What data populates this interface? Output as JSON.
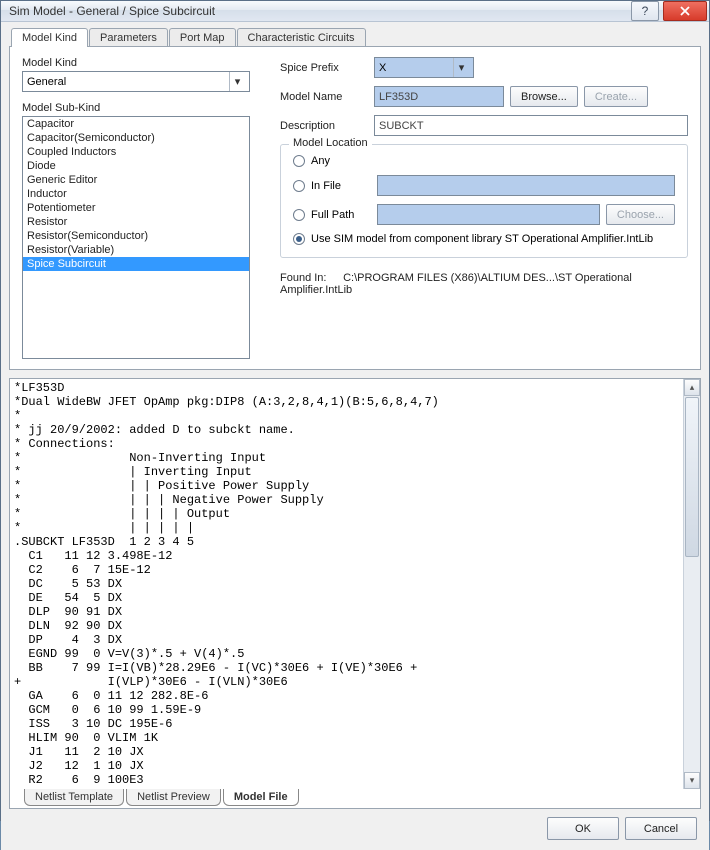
{
  "title": "Sim Model - General / Spice Subcircuit",
  "tabs": [
    "Model Kind",
    "Parameters",
    "Port Map",
    "Characteristic Circuits"
  ],
  "activeTab": 0,
  "modelKind": {
    "label": "Model Kind",
    "value": "General"
  },
  "modelSubKind": {
    "label": "Model Sub-Kind",
    "items": [
      "Capacitor",
      "Capacitor(Semiconductor)",
      "Coupled Inductors",
      "Diode",
      "Generic Editor",
      "Inductor",
      "Potentiometer",
      "Resistor",
      "Resistor(Semiconductor)",
      "Resistor(Variable)",
      "Spice Subcircuit"
    ],
    "selectedIndex": 10
  },
  "right": {
    "spicePrefixLabel": "Spice Prefix",
    "spicePrefix": "X",
    "modelNameLabel": "Model Name",
    "modelName": "LF353D",
    "browse": "Browse...",
    "create": "Create...",
    "descriptionLabel": "Description",
    "description": "SUBCKT"
  },
  "location": {
    "legend": "Model Location",
    "any": "Any",
    "inFile": "In File",
    "fullPath": "Full Path",
    "choose": "Choose...",
    "useLib": "Use SIM model from component library ST Operational Amplifier.IntLib",
    "selected": "useLib"
  },
  "foundIn": {
    "label": "Found In:",
    "value": "C:\\PROGRAM FILES (X86)\\ALTIUM DES...\\ST Operational Amplifier.IntLib"
  },
  "bottomTabs": [
    "Netlist Template",
    "Netlist Preview",
    "Model File"
  ],
  "bottomActive": 2,
  "footer": {
    "ok": "OK",
    "cancel": "Cancel"
  },
  "code": "*LF353D\n*Dual WideBW JFET OpAmp pkg:DIP8 (A:3,2,8,4,1)(B:5,6,8,4,7)\n*\n* jj 20/9/2002: added D to subckt name.\n* Connections:\n*               Non-Inverting Input\n*               | Inverting Input\n*               | | Positive Power Supply\n*               | | | Negative Power Supply\n*               | | | | Output\n*               | | | | |\n.SUBCKT LF353D  1 2 3 4 5\n  C1   11 12 3.498E-12\n  C2    6  7 15E-12\n  DC    5 53 DX\n  DE   54  5 DX\n  DLP  90 91 DX\n  DLN  92 90 DX\n  DP    4  3 DX\n  EGND 99  0 V=V(3)*.5 + V(4)*.5\n  BB    7 99 I=I(VB)*28.29E6 - I(VC)*30E6 + I(VE)*30E6 +\n+            I(VLP)*30E6 - I(VLN)*30E6\n  GA    6  0 11 12 282.8E-6\n  GCM   0  6 10 99 1.59E-9\n  ISS   3 10 DC 195E-6\n  HLIM 90  0 VLIM 1K\n  J1   11  2 10 JX\n  J2   12  1 10 JX\n  R2    6  9 100E3"
}
